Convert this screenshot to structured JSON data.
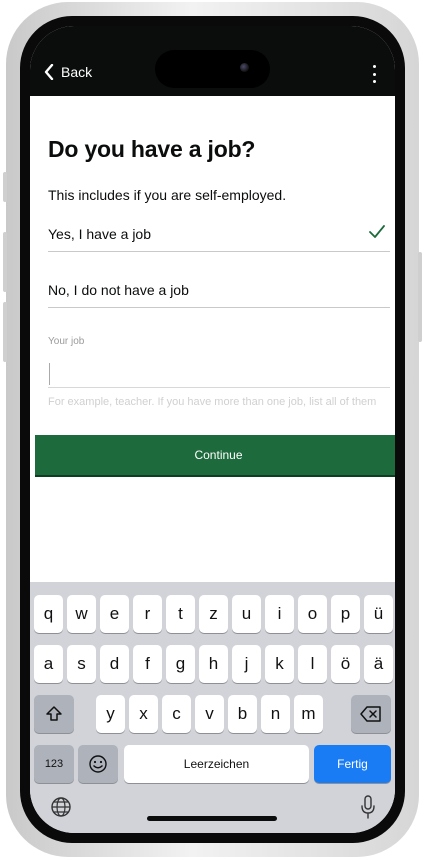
{
  "topbar": {
    "back_label": "Back"
  },
  "question": {
    "title": "Do you have a job?",
    "hint": "This includes if you are self-employed.",
    "options": [
      {
        "label": "Yes, I have a job",
        "selected": true
      },
      {
        "label": "No, I do not have a job",
        "selected": false
      }
    ]
  },
  "job_field": {
    "label": "Your job",
    "value": "",
    "help": "For example, teacher. If you have more than one job, list all of them"
  },
  "continue_label": "Continue",
  "keyboard": {
    "row1": [
      "q",
      "w",
      "e",
      "r",
      "t",
      "z",
      "u",
      "i",
      "o",
      "p",
      "ü"
    ],
    "row2": [
      "a",
      "s",
      "d",
      "f",
      "g",
      "h",
      "j",
      "k",
      "l",
      "ö",
      "ä"
    ],
    "row3": [
      "y",
      "x",
      "c",
      "v",
      "b",
      "n",
      "m"
    ],
    "numbers_label": "123",
    "space_label": "Leerzeichen",
    "done_label": "Fertig"
  },
  "icons": {
    "back": "chevron-left-icon",
    "menu": "kebab-menu-icon",
    "check": "checkmark-icon",
    "shift": "shift-icon",
    "delete": "backspace-icon",
    "emoji": "emoji-icon",
    "globe": "globe-icon",
    "mic": "microphone-icon"
  },
  "colors": {
    "header": "#0b0c0c",
    "continue": "#1d6b3c",
    "check": "#1d6b3c",
    "done_key": "#1a7cf5",
    "keyboard_bg": "#d1d3d9"
  }
}
